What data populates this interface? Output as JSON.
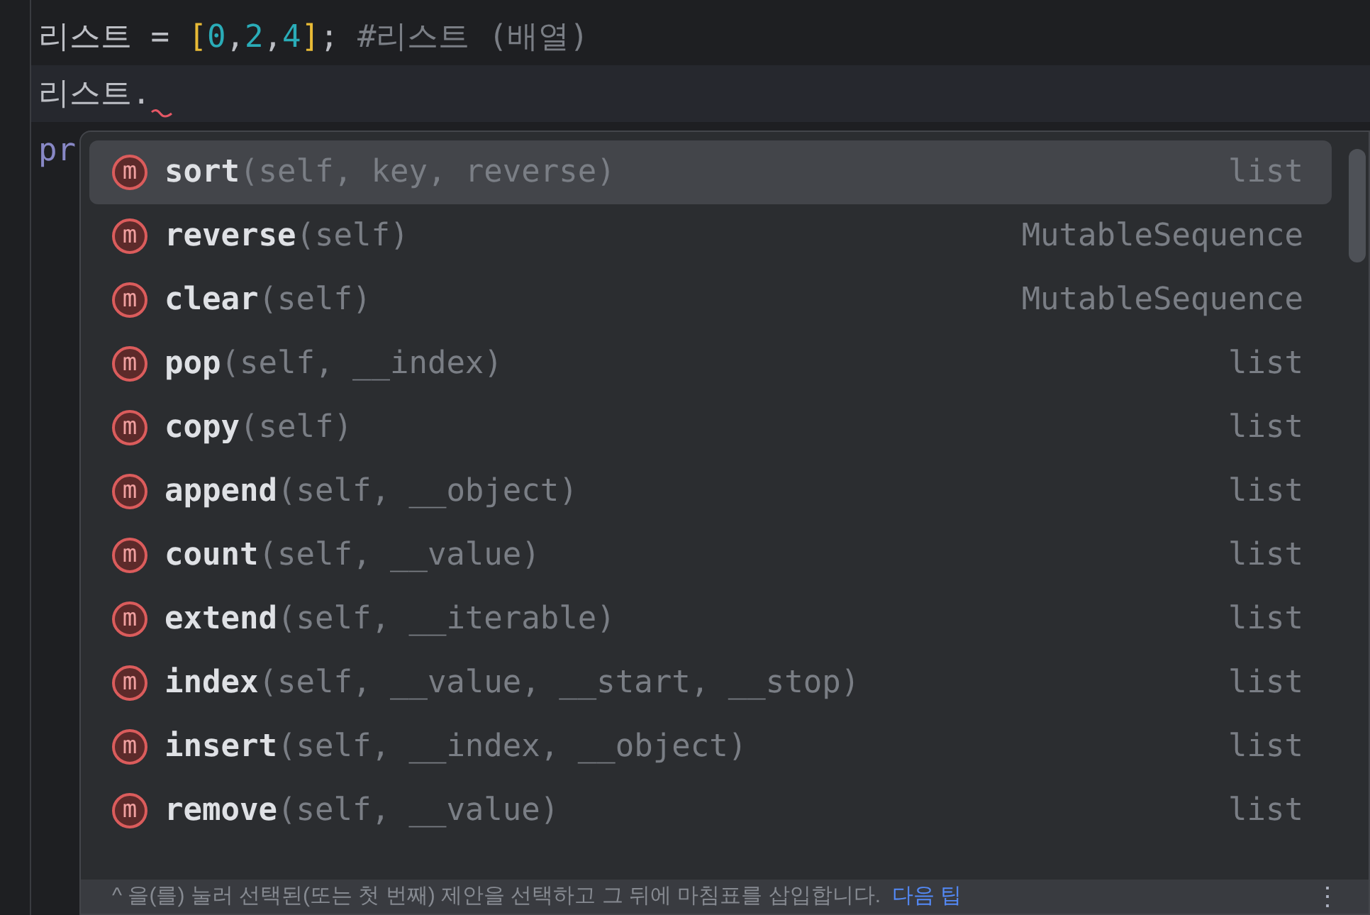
{
  "editor": {
    "lines": [
      {
        "tokens": [
          {
            "kind": "ident",
            "text": "리스트"
          },
          {
            "kind": "op",
            "text": " = "
          },
          {
            "kind": "bracket",
            "text": "["
          },
          {
            "kind": "number",
            "text": "0"
          },
          {
            "kind": "op",
            "text": ","
          },
          {
            "kind": "number",
            "text": "2"
          },
          {
            "kind": "op",
            "text": ","
          },
          {
            "kind": "number",
            "text": "4"
          },
          {
            "kind": "bracket",
            "text": "]"
          },
          {
            "kind": "op",
            "text": "; "
          },
          {
            "kind": "comment",
            "text": "#리스트 (배열)"
          }
        ],
        "current": false,
        "error_mark": false
      },
      {
        "tokens": [
          {
            "kind": "ident",
            "text": "리스트."
          }
        ],
        "current": true,
        "error_mark": true
      },
      {
        "tokens": [
          {
            "kind": "keyword",
            "text": "pr"
          }
        ],
        "current": false,
        "error_mark": false
      }
    ]
  },
  "completion": {
    "items": [
      {
        "kind": "method",
        "icon_text": "m",
        "name": "sort",
        "params": "(self, key, reverse)",
        "type": "list",
        "selected": true
      },
      {
        "kind": "method",
        "icon_text": "m",
        "name": "reverse",
        "params": "(self)",
        "type": "MutableSequence",
        "selected": false
      },
      {
        "kind": "method",
        "icon_text": "m",
        "name": "clear",
        "params": "(self)",
        "type": "MutableSequence",
        "selected": false
      },
      {
        "kind": "method",
        "icon_text": "m",
        "name": "pop",
        "params": "(self, __index)",
        "type": "list",
        "selected": false
      },
      {
        "kind": "method",
        "icon_text": "m",
        "name": "copy",
        "params": "(self)",
        "type": "list",
        "selected": false
      },
      {
        "kind": "method",
        "icon_text": "m",
        "name": "append",
        "params": "(self, __object)",
        "type": "list",
        "selected": false
      },
      {
        "kind": "method",
        "icon_text": "m",
        "name": "count",
        "params": "(self, __value)",
        "type": "list",
        "selected": false
      },
      {
        "kind": "method",
        "icon_text": "m",
        "name": "extend",
        "params": "(self, __iterable)",
        "type": "list",
        "selected": false
      },
      {
        "kind": "method",
        "icon_text": "m",
        "name": "index",
        "params": "(self, __value, __start, __stop)",
        "type": "list",
        "selected": false
      },
      {
        "kind": "method",
        "icon_text": "m",
        "name": "insert",
        "params": "(self, __index, __object)",
        "type": "list",
        "selected": false
      },
      {
        "kind": "method",
        "icon_text": "m",
        "name": "remove",
        "params": "(self, __value)",
        "type": "list",
        "selected": false
      }
    ],
    "hint": {
      "text": "^ 을(를) 눌러 선택된(또는 첫 번째) 제안을 선택하고 그 뒤에 마침표를 삽입합니다.",
      "link": "다음 팁",
      "menu": "⋮"
    }
  }
}
